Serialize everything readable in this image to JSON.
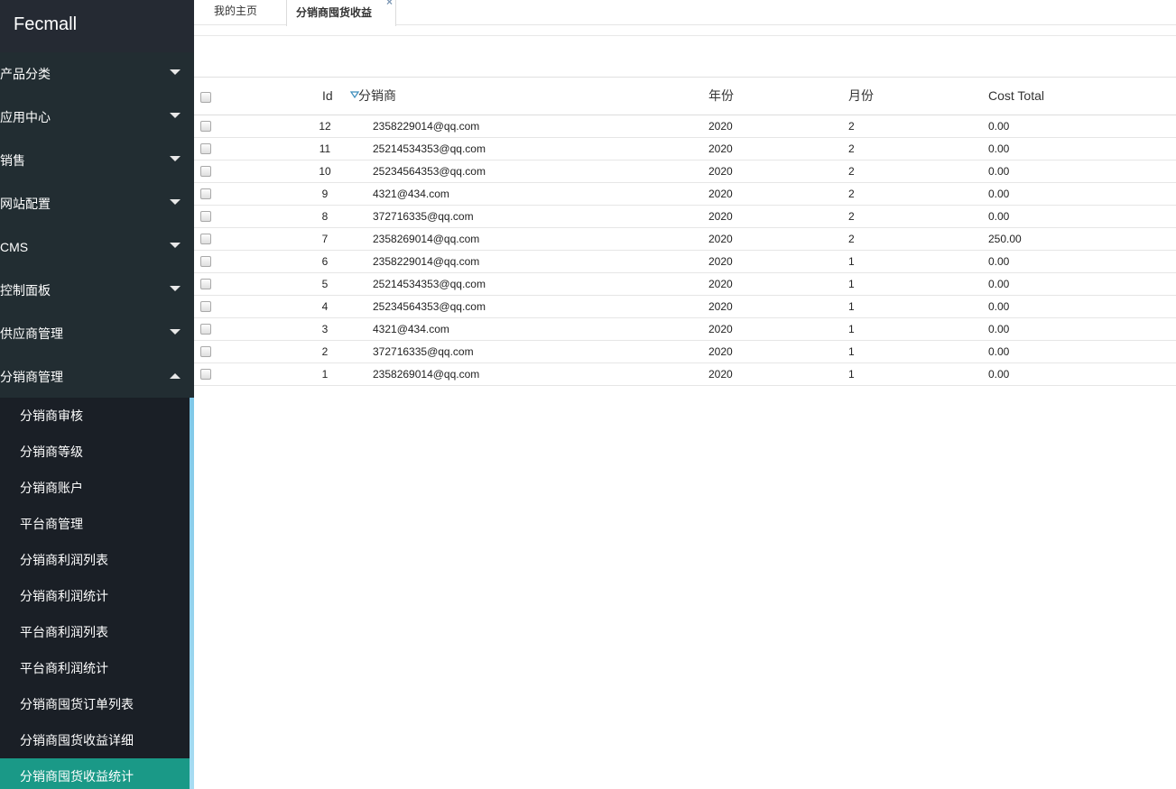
{
  "brand": "Fecmall",
  "menu": [
    {
      "label": "产品分类",
      "expanded": false
    },
    {
      "label": "应用中心",
      "expanded": false
    },
    {
      "label": "销售",
      "expanded": false
    },
    {
      "label": "网站配置",
      "expanded": false
    },
    {
      "label": "CMS",
      "expanded": false
    },
    {
      "label": "控制面板",
      "expanded": false
    },
    {
      "label": "供应商管理",
      "expanded": false
    },
    {
      "label": "分销商管理",
      "expanded": true
    }
  ],
  "submenu": [
    {
      "label": "分销商审核"
    },
    {
      "label": "分销商等级"
    },
    {
      "label": "分销商账户"
    },
    {
      "label": "平台商管理"
    },
    {
      "label": "分销商利润列表"
    },
    {
      "label": "分销商利润统计"
    },
    {
      "label": "平台商利润列表"
    },
    {
      "label": "平台商利润统计"
    },
    {
      "label": "分销商囤货订单列表"
    },
    {
      "label": "分销商囤货收益详细"
    },
    {
      "label": "分销商囤货收益统计",
      "active": true
    }
  ],
  "tabs": {
    "home": "我的主页",
    "active": "分销商囤货收益",
    "close": "×"
  },
  "table": {
    "headers": {
      "id": "Id",
      "name": "分销商",
      "year": "年份",
      "month": "月份",
      "cost": "Cost Total"
    },
    "rows": [
      {
        "id": "12",
        "name": "2358229014@qq.com",
        "year": "2020",
        "month": "2",
        "cost": "0.00"
      },
      {
        "id": "11",
        "name": "25214534353@qq.com",
        "year": "2020",
        "month": "2",
        "cost": "0.00"
      },
      {
        "id": "10",
        "name": "25234564353@qq.com",
        "year": "2020",
        "month": "2",
        "cost": "0.00"
      },
      {
        "id": "9",
        "name": "4321@434.com",
        "year": "2020",
        "month": "2",
        "cost": "0.00"
      },
      {
        "id": "8",
        "name": "372716335@qq.com",
        "year": "2020",
        "month": "2",
        "cost": "0.00"
      },
      {
        "id": "7",
        "name": "2358269014@qq.com",
        "year": "2020",
        "month": "2",
        "cost": "250.00"
      },
      {
        "id": "6",
        "name": "2358229014@qq.com",
        "year": "2020",
        "month": "1",
        "cost": "0.00"
      },
      {
        "id": "5",
        "name": "25214534353@qq.com",
        "year": "2020",
        "month": "1",
        "cost": "0.00"
      },
      {
        "id": "4",
        "name": "25234564353@qq.com",
        "year": "2020",
        "month": "1",
        "cost": "0.00"
      },
      {
        "id": "3",
        "name": "4321@434.com",
        "year": "2020",
        "month": "1",
        "cost": "0.00"
      },
      {
        "id": "2",
        "name": "372716335@qq.com",
        "year": "2020",
        "month": "1",
        "cost": "0.00"
      },
      {
        "id": "1",
        "name": "2358269014@qq.com",
        "year": "2020",
        "month": "1",
        "cost": "0.00"
      }
    ]
  },
  "colors": {
    "sidebar": "#222d32",
    "submenu": "#1a1f26",
    "active_item": "#1a9987",
    "sort_icon": "#3c8dbc"
  }
}
